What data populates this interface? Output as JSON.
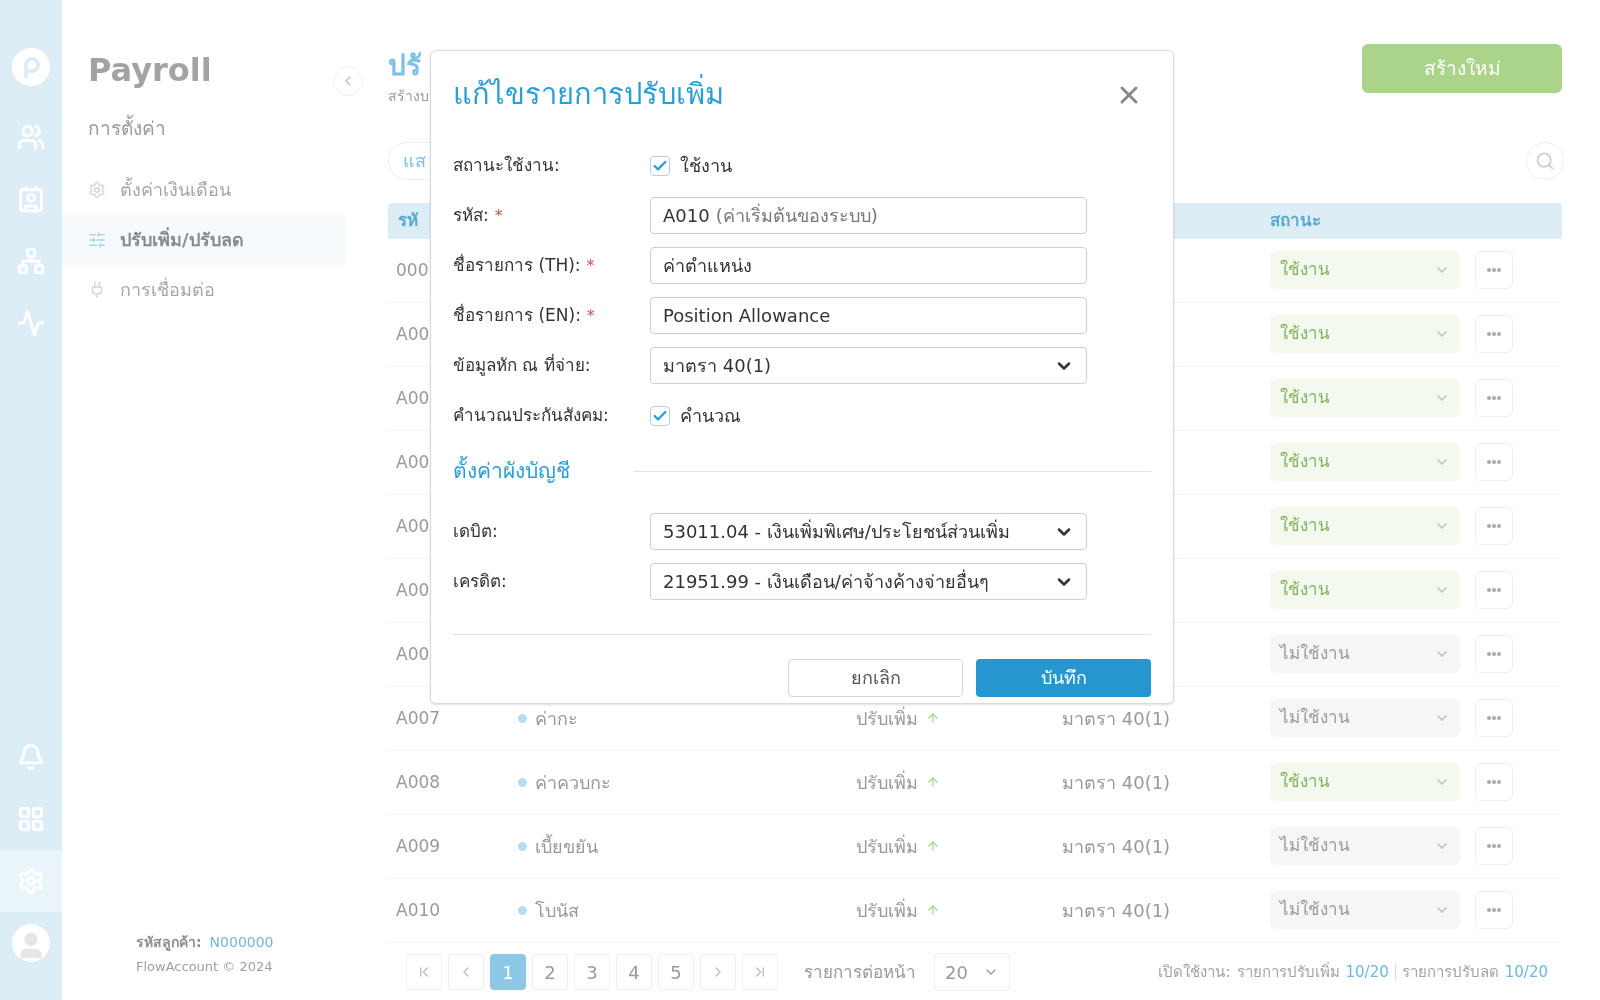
{
  "rail": [
    {
      "kind": "employees",
      "selected": false
    },
    {
      "kind": "badge",
      "selected": false
    },
    {
      "kind": "org",
      "selected": false
    },
    {
      "kind": "monitor",
      "selected": false
    },
    {
      "kind": "bell",
      "selected": false
    },
    {
      "kind": "apps",
      "selected": false
    },
    {
      "kind": "settings",
      "selected": true
    }
  ],
  "sidebar": {
    "title": "Payroll",
    "section": "การตั้งค่า",
    "items": [
      {
        "label": "ตั้งค่าเงินเดือน",
        "kind": "gear",
        "selected": false
      },
      {
        "label": "ปรับเพิ่ม/ปรับลด",
        "kind": "sliders",
        "selected": true
      },
      {
        "label": "การเชื่อมต่อ",
        "kind": "plug",
        "selected": false
      }
    ],
    "customer_label": "รหัสลูกค้า:",
    "customer_code": "N000000",
    "copyright": "FlowAccount © 2024"
  },
  "page": {
    "title": "ปรั",
    "subtitle": "สร้างบ",
    "create_button": "สร้างใหม่",
    "filter_pill": "แส"
  },
  "table": {
    "columns": [
      "รหั",
      "สถานะ"
    ],
    "rows": [
      {
        "code": "000",
        "status": "ใช้งาน",
        "active": true
      },
      {
        "code": "A00",
        "status": "ใช้งาน",
        "active": true
      },
      {
        "code": "A00",
        "status": "ใช้งาน",
        "active": true
      },
      {
        "code": "A00",
        "status": "ใช้งาน",
        "active": true
      },
      {
        "code": "A00",
        "status": "ใช้งาน",
        "active": true
      },
      {
        "code": "A00",
        "status": "ใช้งาน",
        "active": true
      },
      {
        "code": "A00",
        "status": "ไม่ใช้งาน",
        "active": false
      },
      {
        "code": "A007",
        "name": "ค่ากะ",
        "type": "ปรับเพิ่ม",
        "tax": "มาตรา 40(1)",
        "status": "ไม่ใช้งาน",
        "active": false
      },
      {
        "code": "A008",
        "name": "ค่าควบกะ",
        "type": "ปรับเพิ่ม",
        "tax": "มาตรา 40(1)",
        "status": "ใช้งาน",
        "active": true
      },
      {
        "code": "A009",
        "name": "เบี้ยขยัน",
        "type": "ปรับเพิ่ม",
        "tax": "มาตรา 40(1)",
        "status": "ไม่ใช้งาน",
        "active": false
      },
      {
        "code": "A010",
        "name": "โบนัส",
        "type": "ปรับเพิ่ม",
        "tax": "มาตรา 40(1)",
        "status": "ไม่ใช้งาน",
        "active": false
      }
    ]
  },
  "pagination": {
    "pages": [
      {
        "label": "1",
        "selected": true
      },
      {
        "label": "2",
        "selected": false
      },
      {
        "label": "3",
        "selected": false
      },
      {
        "label": "4",
        "selected": false
      },
      {
        "label": "5",
        "selected": false
      }
    ],
    "per_page_label": "รายการต่อหน้า",
    "per_page": "20",
    "summary_label": "เปิดใช้งาน:",
    "increase_label": "รายการปรับเพิ่ม",
    "increase_count": "10/20",
    "decrease_label": "รายการปรับลด",
    "decrease_count": "10/20"
  },
  "modal": {
    "title": "แก้ไขรายการปรับเพิ่ม",
    "fields": [
      {
        "kind": "checkbox",
        "label": "สถานะใช้งาน:",
        "checked": true,
        "text": "ใช้งาน"
      },
      {
        "kind": "input",
        "label": "รหัส:",
        "required_mark": "*",
        "value": "A010",
        "note": "(ค่าเริ่มต้นของระบบ)"
      },
      {
        "kind": "input",
        "label": "ชื่อรายการ (TH):",
        "required_mark": "*",
        "value": "ค่าตำแหน่ง"
      },
      {
        "kind": "input",
        "label": "ชื่อรายการ (EN):",
        "required_mark": "*",
        "value": "Position Allowance"
      },
      {
        "kind": "select",
        "label": "ข้อมูลหัก ณ ที่จ่าย:",
        "value": "มาตรา 40(1)"
      },
      {
        "kind": "checkbox",
        "label": "คำนวณประกันสังคม:",
        "checked": true,
        "text": "คำนวณ"
      }
    ],
    "section_title": "ตั้งค่าผังบัญชี",
    "account_fields": [
      {
        "kind": "select",
        "label": "เดบิต:",
        "value": "53011.04 - เงินเพิ่มพิเศษ/ประโยชน์ส่วนเพิ่ม"
      },
      {
        "kind": "select",
        "label": "เครดิต:",
        "value": "21951.99 - เงินเดือน/ค่าจ้างค้างจ่ายอื่นๆ"
      }
    ],
    "cancel_button": "ยกเลิก",
    "save_button": "บันทึก"
  }
}
